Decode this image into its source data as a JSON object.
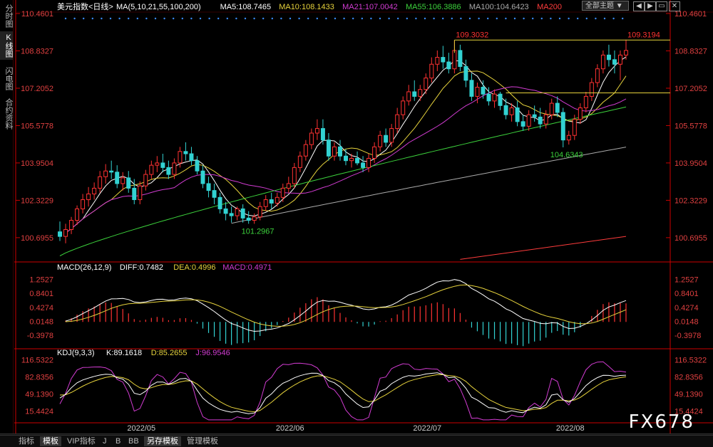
{
  "main": {
    "ma_legend": [
      {
        "label": "美元指数<日线>",
        "color": "#ffffff"
      },
      {
        "label": "MA(5,10,21,55,100,200)",
        "color": "#ffffff"
      },
      {
        "label": "MA5:108.7465",
        "color": "#ffffff"
      },
      {
        "label": "MA10:108.1433",
        "color": "#e6d23c"
      },
      {
        "label": "MA21:107.0042",
        "color": "#d23cd2"
      },
      {
        "label": "MA55:106.3886",
        "color": "#3cd23c"
      },
      {
        "label": "MA100:104.6423",
        "color": "#aaaaaa"
      },
      {
        "label": "MA200",
        "color": "#ff3c3c"
      }
    ],
    "theme_button": "全部主题",
    "sidebar_tabs": [
      "分时图",
      "K线图",
      "闪电图",
      "合约资料"
    ],
    "bottom_tabs": [
      "指标",
      "模板",
      "VIP指标",
      "J",
      "B",
      "BB",
      "另存模板",
      "管理模板"
    ],
    "period_label": "日线",
    "watermark": "FX678",
    "colors": {
      "up": "#ff3232",
      "down": "#32d2d2",
      "axis": "#cc0000",
      "label": "#e04040"
    }
  },
  "chart_data": [
    {
      "type": "candlestick",
      "title": "美元指数<日线>",
      "ylim": [
        99.7,
        110.8
      ],
      "yticks": [
        "110.4601",
        "108.8327",
        "107.2052",
        "105.5778",
        "103.9504",
        "102.3229",
        "100.6955"
      ],
      "x_labels": [
        "2022/05",
        "2022/06",
        "2022/07",
        "2022/08"
      ],
      "annotations": [
        "109.3032",
        "109.3194",
        "101.2967",
        "104.6343"
      ],
      "ohlc": [
        [
          100.95,
          101.4,
          100.55,
          100.75
        ],
        [
          100.75,
          101.3,
          100.45,
          101.05
        ],
        [
          101.05,
          101.6,
          100.85,
          101.45
        ],
        [
          101.45,
          102.1,
          101.25,
          101.95
        ],
        [
          101.95,
          102.6,
          101.75,
          102.35
        ],
        [
          102.35,
          102.9,
          102.05,
          102.6
        ],
        [
          102.6,
          103.1,
          102.35,
          102.85
        ],
        [
          102.85,
          103.6,
          102.65,
          103.35
        ],
        [
          103.35,
          103.9,
          103.05,
          103.6
        ],
        [
          103.6,
          104.05,
          103.25,
          103.55
        ],
        [
          103.55,
          103.85,
          102.85,
          103.05
        ],
        [
          103.05,
          103.55,
          102.75,
          103.3
        ],
        [
          103.3,
          103.6,
          102.65,
          102.85
        ],
        [
          102.85,
          103.25,
          102.15,
          102.35
        ],
        [
          102.35,
          103.15,
          102.15,
          102.95
        ],
        [
          102.95,
          103.65,
          102.75,
          103.45
        ],
        [
          103.45,
          104.05,
          103.25,
          103.85
        ],
        [
          103.85,
          104.25,
          103.55,
          103.95
        ],
        [
          103.95,
          104.35,
          103.55,
          103.75
        ],
        [
          103.75,
          104.05,
          103.25,
          103.45
        ],
        [
          103.45,
          104.15,
          103.25,
          103.95
        ],
        [
          103.95,
          104.65,
          103.75,
          104.45
        ],
        [
          104.45,
          104.85,
          104.05,
          104.35
        ],
        [
          104.35,
          104.65,
          103.85,
          104.05
        ],
        [
          104.05,
          104.25,
          103.45,
          103.6
        ],
        [
          103.6,
          103.85,
          102.85,
          103.05
        ],
        [
          103.05,
          103.35,
          102.45,
          102.75
        ],
        [
          102.75,
          103.05,
          102.15,
          102.45
        ],
        [
          102.45,
          102.65,
          101.75,
          101.95
        ],
        [
          101.95,
          102.25,
          101.45,
          101.75
        ],
        [
          101.75,
          102.05,
          101.35,
          101.65
        ],
        [
          101.65,
          102.05,
          101.45,
          101.95
        ],
        [
          101.95,
          102.15,
          101.35,
          101.55
        ],
        [
          101.55,
          101.85,
          101.3,
          101.45
        ],
        [
          101.45,
          101.75,
          101.3,
          101.6
        ],
        [
          101.6,
          102.25,
          101.45,
          102.05
        ],
        [
          102.05,
          102.55,
          101.85,
          102.35
        ],
        [
          102.35,
          102.65,
          101.95,
          102.2
        ],
        [
          102.2,
          102.65,
          102.05,
          102.45
        ],
        [
          102.45,
          103.05,
          102.25,
          102.85
        ],
        [
          102.85,
          103.35,
          102.65,
          103.05
        ],
        [
          103.05,
          103.95,
          102.85,
          103.75
        ],
        [
          103.75,
          104.45,
          103.55,
          104.25
        ],
        [
          104.25,
          104.95,
          104.05,
          104.75
        ],
        [
          104.75,
          105.45,
          104.55,
          105.25
        ],
        [
          105.25,
          105.85,
          104.95,
          105.45
        ],
        [
          105.45,
          105.85,
          104.75,
          104.95
        ],
        [
          104.95,
          105.25,
          104.05,
          104.25
        ],
        [
          104.25,
          104.85,
          104.05,
          104.65
        ],
        [
          104.65,
          104.95,
          104.05,
          104.25
        ],
        [
          104.25,
          104.55,
          103.85,
          104.05
        ],
        [
          104.05,
          104.35,
          103.75,
          104.15
        ],
        [
          104.15,
          104.45,
          103.85,
          103.95
        ],
        [
          103.95,
          104.25,
          103.55,
          103.75
        ],
        [
          103.75,
          104.35,
          103.55,
          104.15
        ],
        [
          104.15,
          104.85,
          103.95,
          104.65
        ],
        [
          104.65,
          105.35,
          104.45,
          105.15
        ],
        [
          105.15,
          105.45,
          104.65,
          104.85
        ],
        [
          104.85,
          105.65,
          104.65,
          105.45
        ],
        [
          105.45,
          106.35,
          105.25,
          106.05
        ],
        [
          106.05,
          106.85,
          105.85,
          106.65
        ],
        [
          106.65,
          107.35,
          106.45,
          107.05
        ],
        [
          107.05,
          107.55,
          106.65,
          106.85
        ],
        [
          106.85,
          107.35,
          106.65,
          107.15
        ],
        [
          107.15,
          107.85,
          106.95,
          107.65
        ],
        [
          107.65,
          108.55,
          107.45,
          108.25
        ],
        [
          108.25,
          108.85,
          107.95,
          108.55
        ],
        [
          108.55,
          109.05,
          108.05,
          108.35
        ],
        [
          108.35,
          108.75,
          107.85,
          108.05
        ],
        [
          108.05,
          109.3,
          107.85,
          108.85
        ],
        [
          108.85,
          109.1,
          107.95,
          108.15
        ],
        [
          108.15,
          108.45,
          107.25,
          107.55
        ],
        [
          107.55,
          107.85,
          106.65,
          106.85
        ],
        [
          106.85,
          107.45,
          106.55,
          107.25
        ],
        [
          107.25,
          107.55,
          106.75,
          106.95
        ],
        [
          106.95,
          107.25,
          106.45,
          106.65
        ],
        [
          106.65,
          107.15,
          106.35,
          106.95
        ],
        [
          106.95,
          107.05,
          106.25,
          106.45
        ],
        [
          106.45,
          106.75,
          105.85,
          106.05
        ],
        [
          106.05,
          106.55,
          105.75,
          106.35
        ],
        [
          106.35,
          106.65,
          105.55,
          105.75
        ],
        [
          105.75,
          106.05,
          105.35,
          105.55
        ],
        [
          105.55,
          106.25,
          105.35,
          106.05
        ],
        [
          106.05,
          106.45,
          105.75,
          105.95
        ],
        [
          105.95,
          106.35,
          105.45,
          105.65
        ],
        [
          105.65,
          106.25,
          105.45,
          106.05
        ],
        [
          106.05,
          106.75,
          105.85,
          106.55
        ],
        [
          106.55,
          106.85,
          105.95,
          106.15
        ],
        [
          106.15,
          106.35,
          104.63,
          104.95
        ],
        [
          104.95,
          105.35,
          104.75,
          105.15
        ],
        [
          105.15,
          106.05,
          104.95,
          105.85
        ],
        [
          105.85,
          106.55,
          105.65,
          106.35
        ],
        [
          106.35,
          107.05,
          106.15,
          106.85
        ],
        [
          106.85,
          107.65,
          106.65,
          107.45
        ],
        [
          107.45,
          108.25,
          107.25,
          108.05
        ],
        [
          108.05,
          108.85,
          107.85,
          108.65
        ],
        [
          108.65,
          109.1,
          108.15,
          108.45
        ],
        [
          108.45,
          108.85,
          107.85,
          108.25
        ],
        [
          108.25,
          108.85,
          107.55,
          108.65
        ],
        [
          108.65,
          109.32,
          108.45,
          108.85
        ]
      ],
      "ma_latest": {
        "MA5": 108.7465,
        "MA10": 108.1433,
        "MA21": 107.0042,
        "MA55": 106.3886,
        "MA100": 104.6423
      }
    },
    {
      "type": "macd",
      "title": "MACD(26,12,9)",
      "legend": [
        {
          "label": "MACD(26,12,9)",
          "color": "#ffffff"
        },
        {
          "label": "DIFF:0.7482",
          "color": "#ffffff"
        },
        {
          "label": "DEA:0.4996",
          "color": "#e6d23c"
        },
        {
          "label": "MACD:0.4971",
          "color": "#d23cd2"
        }
      ],
      "ylim": [
        -0.75,
        1.6
      ],
      "yticks": [
        "1.2527",
        "0.8401",
        "0.4274",
        "0.0148",
        "-0.3978"
      ]
    },
    {
      "type": "kdj",
      "title": "KDJ(9,3,3)",
      "legend": [
        {
          "label": "KDJ(9,3,3)",
          "color": "#ffffff"
        },
        {
          "label": "K:89.1618",
          "color": "#ffffff"
        },
        {
          "label": "D:85.2655",
          "color": "#e6d23c"
        },
        {
          "label": "J:96.9546",
          "color": "#d23cd2"
        }
      ],
      "ylim": [
        -5,
        130
      ],
      "yticks": [
        "116.5322",
        "82.8356",
        "49.1390",
        "15.4424"
      ]
    }
  ]
}
